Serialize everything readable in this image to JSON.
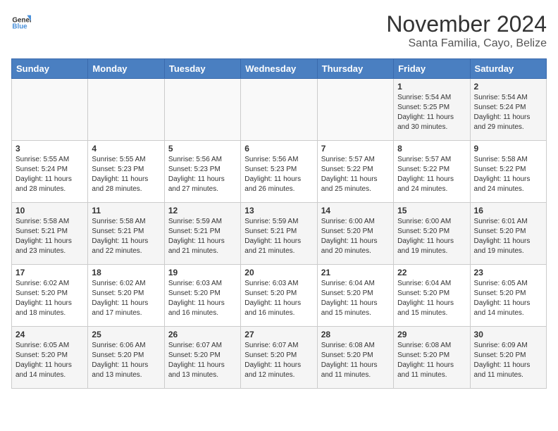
{
  "logo": {
    "line1": "General",
    "line2": "Blue"
  },
  "title": "November 2024",
  "subtitle": "Santa Familia, Cayo, Belize",
  "weekdays": [
    "Sunday",
    "Monday",
    "Tuesday",
    "Wednesday",
    "Thursday",
    "Friday",
    "Saturday"
  ],
  "weeks": [
    [
      {
        "day": "",
        "info": ""
      },
      {
        "day": "",
        "info": ""
      },
      {
        "day": "",
        "info": ""
      },
      {
        "day": "",
        "info": ""
      },
      {
        "day": "",
        "info": ""
      },
      {
        "day": "1",
        "info": "Sunrise: 5:54 AM\nSunset: 5:25 PM\nDaylight: 11 hours\nand 30 minutes."
      },
      {
        "day": "2",
        "info": "Sunrise: 5:54 AM\nSunset: 5:24 PM\nDaylight: 11 hours\nand 29 minutes."
      }
    ],
    [
      {
        "day": "3",
        "info": "Sunrise: 5:55 AM\nSunset: 5:24 PM\nDaylight: 11 hours\nand 28 minutes."
      },
      {
        "day": "4",
        "info": "Sunrise: 5:55 AM\nSunset: 5:23 PM\nDaylight: 11 hours\nand 28 minutes."
      },
      {
        "day": "5",
        "info": "Sunrise: 5:56 AM\nSunset: 5:23 PM\nDaylight: 11 hours\nand 27 minutes."
      },
      {
        "day": "6",
        "info": "Sunrise: 5:56 AM\nSunset: 5:23 PM\nDaylight: 11 hours\nand 26 minutes."
      },
      {
        "day": "7",
        "info": "Sunrise: 5:57 AM\nSunset: 5:22 PM\nDaylight: 11 hours\nand 25 minutes."
      },
      {
        "day": "8",
        "info": "Sunrise: 5:57 AM\nSunset: 5:22 PM\nDaylight: 11 hours\nand 24 minutes."
      },
      {
        "day": "9",
        "info": "Sunrise: 5:58 AM\nSunset: 5:22 PM\nDaylight: 11 hours\nand 24 minutes."
      }
    ],
    [
      {
        "day": "10",
        "info": "Sunrise: 5:58 AM\nSunset: 5:21 PM\nDaylight: 11 hours\nand 23 minutes."
      },
      {
        "day": "11",
        "info": "Sunrise: 5:58 AM\nSunset: 5:21 PM\nDaylight: 11 hours\nand 22 minutes."
      },
      {
        "day": "12",
        "info": "Sunrise: 5:59 AM\nSunset: 5:21 PM\nDaylight: 11 hours\nand 21 minutes."
      },
      {
        "day": "13",
        "info": "Sunrise: 5:59 AM\nSunset: 5:21 PM\nDaylight: 11 hours\nand 21 minutes."
      },
      {
        "day": "14",
        "info": "Sunrise: 6:00 AM\nSunset: 5:20 PM\nDaylight: 11 hours\nand 20 minutes."
      },
      {
        "day": "15",
        "info": "Sunrise: 6:00 AM\nSunset: 5:20 PM\nDaylight: 11 hours\nand 19 minutes."
      },
      {
        "day": "16",
        "info": "Sunrise: 6:01 AM\nSunset: 5:20 PM\nDaylight: 11 hours\nand 19 minutes."
      }
    ],
    [
      {
        "day": "17",
        "info": "Sunrise: 6:02 AM\nSunset: 5:20 PM\nDaylight: 11 hours\nand 18 minutes."
      },
      {
        "day": "18",
        "info": "Sunrise: 6:02 AM\nSunset: 5:20 PM\nDaylight: 11 hours\nand 17 minutes."
      },
      {
        "day": "19",
        "info": "Sunrise: 6:03 AM\nSunset: 5:20 PM\nDaylight: 11 hours\nand 16 minutes."
      },
      {
        "day": "20",
        "info": "Sunrise: 6:03 AM\nSunset: 5:20 PM\nDaylight: 11 hours\nand 16 minutes."
      },
      {
        "day": "21",
        "info": "Sunrise: 6:04 AM\nSunset: 5:20 PM\nDaylight: 11 hours\nand 15 minutes."
      },
      {
        "day": "22",
        "info": "Sunrise: 6:04 AM\nSunset: 5:20 PM\nDaylight: 11 hours\nand 15 minutes."
      },
      {
        "day": "23",
        "info": "Sunrise: 6:05 AM\nSunset: 5:20 PM\nDaylight: 11 hours\nand 14 minutes."
      }
    ],
    [
      {
        "day": "24",
        "info": "Sunrise: 6:05 AM\nSunset: 5:20 PM\nDaylight: 11 hours\nand 14 minutes."
      },
      {
        "day": "25",
        "info": "Sunrise: 6:06 AM\nSunset: 5:20 PM\nDaylight: 11 hours\nand 13 minutes."
      },
      {
        "day": "26",
        "info": "Sunrise: 6:07 AM\nSunset: 5:20 PM\nDaylight: 11 hours\nand 13 minutes."
      },
      {
        "day": "27",
        "info": "Sunrise: 6:07 AM\nSunset: 5:20 PM\nDaylight: 11 hours\nand 12 minutes."
      },
      {
        "day": "28",
        "info": "Sunrise: 6:08 AM\nSunset: 5:20 PM\nDaylight: 11 hours\nand 11 minutes."
      },
      {
        "day": "29",
        "info": "Sunrise: 6:08 AM\nSunset: 5:20 PM\nDaylight: 11 hours\nand 11 minutes."
      },
      {
        "day": "30",
        "info": "Sunrise: 6:09 AM\nSunset: 5:20 PM\nDaylight: 11 hours\nand 11 minutes."
      }
    ]
  ]
}
